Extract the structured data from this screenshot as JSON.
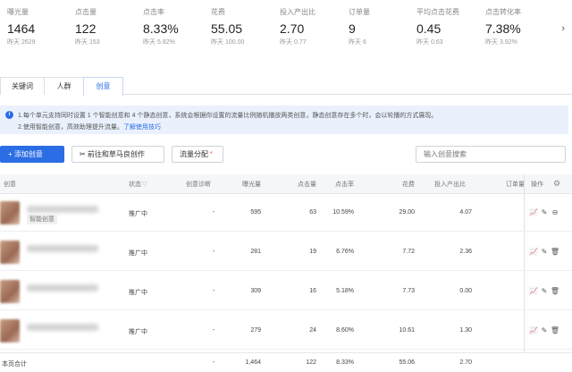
{
  "metrics": [
    {
      "label": "曝光量",
      "value": "1464",
      "sub_label": "昨天",
      "sub_value": "2629"
    },
    {
      "label": "点击量",
      "value": "122",
      "sub_label": "昨天",
      "sub_value": "153"
    },
    {
      "label": "点击率",
      "value": "8.33%",
      "sub_label": "昨天",
      "sub_value": "5.82%"
    },
    {
      "label": "花费",
      "value": "55.05",
      "sub_label": "昨天",
      "sub_value": "100.00"
    },
    {
      "label": "投入产出比",
      "value": "2.70",
      "sub_label": "昨天",
      "sub_value": "0.77"
    },
    {
      "label": "订单量",
      "value": "9",
      "sub_label": "昨天",
      "sub_value": "6"
    },
    {
      "label": "平均点击花费",
      "value": "0.45",
      "sub_label": "昨天",
      "sub_value": "0.63"
    },
    {
      "label": "点击转化率",
      "value": "7.38%",
      "sub_label": "昨天",
      "sub_value": "3.92%"
    }
  ],
  "metrics_arrow": "›",
  "tabs": [
    {
      "label": "关键词"
    },
    {
      "label": "人群"
    },
    {
      "label": "创意"
    }
  ],
  "notice": {
    "icon": "i",
    "line1": "1.每个单元支持同时设置 1 个智能创意和 4 个静态创意，系统会根据你设置的流量比例随机播放两类创意，静态创意存在多个时，会以轮播的方式展现。",
    "line2_prefix": "2.使用智能创意，高效助理提升流量。",
    "line2_link": "了解使用技巧"
  },
  "toolbar": {
    "add_label": "+ 添加创意",
    "go_label": "✂ 前往和草马良创作",
    "flow_label": "流量分配",
    "flow_mark": "*",
    "search_placeholder": "输入创意搜索"
  },
  "table": {
    "headers": {
      "name": "创意",
      "status": "状态",
      "status_sort": "▽",
      "diag": "创意诊断",
      "impressions": "曝光量",
      "clicks": "点击量",
      "ctr": "点击率",
      "cost": "花费",
      "roi": "投入产出比",
      "orders": "订单量",
      "ops": "操作"
    },
    "rows": [
      {
        "tag": "智能创意",
        "status": "推广中",
        "diag": "-",
        "impressions": "595",
        "clicks": "63",
        "ctr": "10.59%",
        "cost": "29.00",
        "roi": "4.07"
      },
      {
        "tag": "",
        "status": "推广中",
        "diag": "-",
        "impressions": "281",
        "clicks": "19",
        "ctr": "6.76%",
        "cost": "7.72",
        "roi": "2.36"
      },
      {
        "tag": "",
        "status": "推广中",
        "diag": "-",
        "impressions": "309",
        "clicks": "16",
        "ctr": "5.18%",
        "cost": "7.73",
        "roi": "0.00"
      },
      {
        "tag": "",
        "status": "推广中",
        "diag": "-",
        "impressions": "279",
        "clicks": "24",
        "ctr": "8.60%",
        "cost": "10.61",
        "roi": "1.30"
      }
    ],
    "footer": {
      "label": "本页合计",
      "diag": "-",
      "impressions": "1,464",
      "clicks": "122",
      "ctr": "8.33%",
      "cost": "55.06",
      "roi": "2.70"
    },
    "op_icons": [
      "📈",
      "✎",
      "⊖"
    ],
    "op_icons_alt": [
      "📈",
      "✎",
      "🗑"
    ]
  }
}
